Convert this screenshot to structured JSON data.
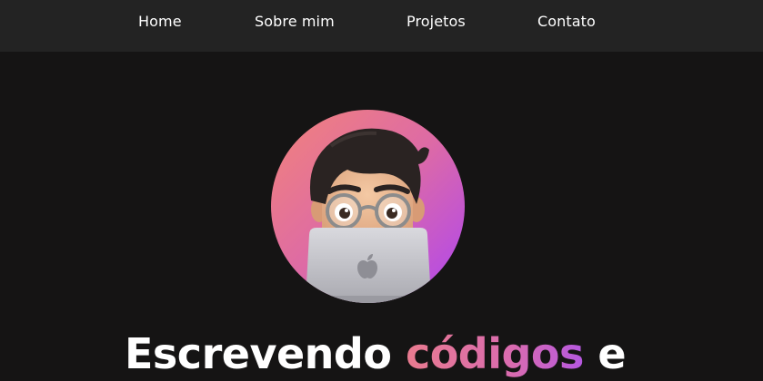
{
  "nav": {
    "items": [
      {
        "label": "Home"
      },
      {
        "label": "Sobre mim"
      },
      {
        "label": "Projetos"
      },
      {
        "label": "Contato"
      }
    ]
  },
  "hero": {
    "avatar_icon": "memoji-laptop-avatar",
    "headline_part1": "Escrevendo ",
    "headline_accent": "códigos",
    "headline_part2": " e"
  },
  "colors": {
    "page_background": "#151414",
    "nav_background": "#232323",
    "text": "#ffffff",
    "gradient_start": "#ee7f7f",
    "gradient_end": "#b148f0"
  }
}
